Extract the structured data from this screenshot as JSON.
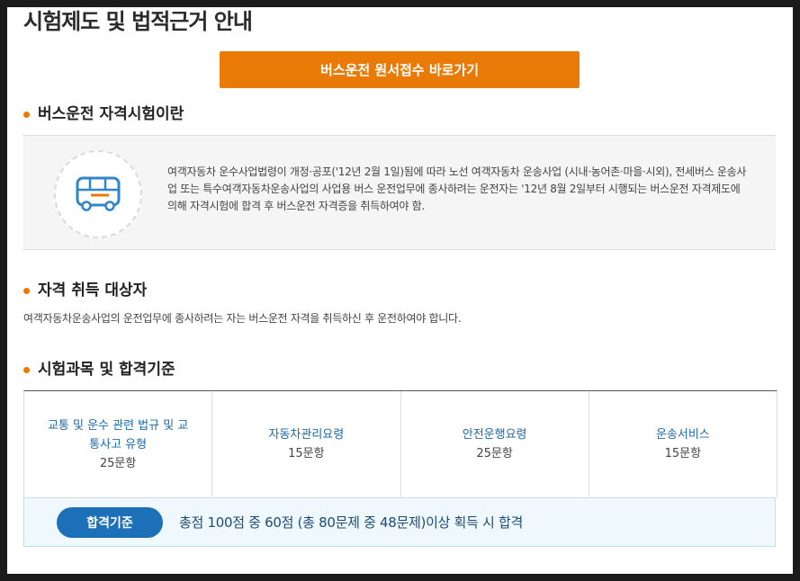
{
  "page": {
    "title": "시험제도 및 법적근거 안내",
    "apply_button": "버스운전 원서접수 바로가기"
  },
  "sections": {
    "about": {
      "title": "버스운전 자격시험이란",
      "text": "여객자동차 운수사업법령이 개정·공포('12년 2월 1일)됨에 따라 노선 여객자동차 운송사업 (시내·농어촌·마을·시외), 전세버스 운송사업 또는 특수여객자동차운송사업의 사업용 버스 운전업무에 종사하려는 운전자는 '12년 8월 2일부터 시행되는 버스운전 자격제도에 의해 자격시험에 합격 후 버스운전 자격증을 취득하여야 함.",
      "icon": "bus-icon"
    },
    "target": {
      "title": "자격 취득 대상자",
      "text": "여객자동차운송사업의 운전업무에 종사하려는 자는 버스운전 자격을 취득하신 후 운전하여야 합니다."
    },
    "subjects": {
      "title": "시험과목 및 합격기준",
      "items": [
        {
          "name": "교통 및 운수 관련 법규 및 교통사고 유형",
          "count": "25문항"
        },
        {
          "name": "자동차관리요령",
          "count": "15문항"
        },
        {
          "name": "안전운행요령",
          "count": "25문항"
        },
        {
          "name": "운송서비스",
          "count": "15문항"
        }
      ],
      "pass_label": "합격기준",
      "pass_text": "총점 100점 중 60점 (총 80문제 중 48문제)이상 획득 시 합격"
    }
  },
  "colors": {
    "accent": "#ea7a06",
    "badge": "#1b70b8",
    "link": "#1c6aa8"
  }
}
